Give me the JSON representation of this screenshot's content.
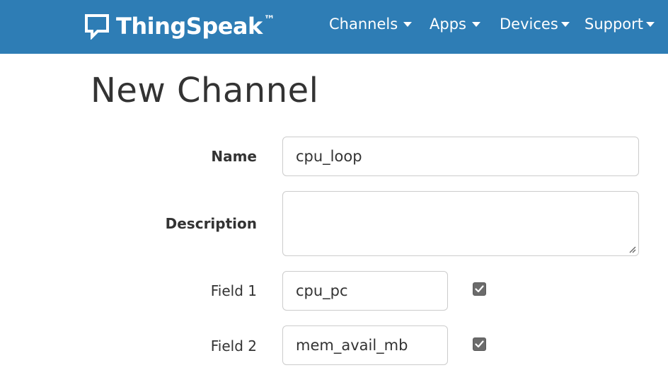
{
  "navbar": {
    "brand": "ThingSpeak",
    "trademark": "™",
    "items": [
      {
        "label": "Channels"
      },
      {
        "label": "Apps"
      },
      {
        "label": "Devices"
      },
      {
        "label": "Support"
      }
    ],
    "color": "#2e7db5"
  },
  "page": {
    "title": "New Channel"
  },
  "form": {
    "name_label": "Name",
    "name_value": "cpu_loop",
    "description_label": "Description",
    "description_value": "",
    "field1_label": "Field 1",
    "field1_value": "cpu_pc",
    "field1_checked": true,
    "field2_label": "Field 2",
    "field2_value": "mem_avail_mb",
    "field2_checked": true
  }
}
